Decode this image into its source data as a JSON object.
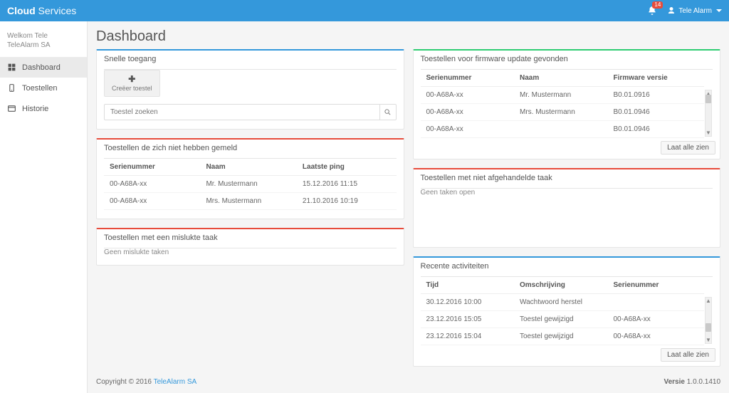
{
  "header": {
    "brand_bold": "Cloud",
    "brand_light": "Services",
    "notif_count": "14",
    "user_label": "Tele Alarm"
  },
  "sidebar": {
    "welcome_line1": "Welkom Tele",
    "welcome_line2": "TeleAlarm SA",
    "items": [
      {
        "label": "Dashboard"
      },
      {
        "label": "Toestellen"
      },
      {
        "label": "Historie"
      }
    ]
  },
  "page": {
    "title": "Dashboard"
  },
  "quick": {
    "title": "Snelle toegang",
    "create_label": "Creëer toestel",
    "search_placeholder": "Toestel zoeken"
  },
  "firmware": {
    "title": "Toestellen voor firmware update gevonden",
    "cols": {
      "serial": "Serienummer",
      "name": "Naam",
      "version": "Firmware versie"
    },
    "rows": [
      {
        "serial": "00-A68A-xx",
        "name": "Mr. Mustermann",
        "version": "B0.01.0916"
      },
      {
        "serial": "00-A68A-xx",
        "name": "Mrs. Mustermann",
        "version": "B0.01.0946"
      },
      {
        "serial": "00-A68A-xx",
        "name": "",
        "version": "B0.01.0946"
      }
    ],
    "footer_btn": "Laat alle zien"
  },
  "noreport": {
    "title": "Toestellen de zich niet hebben gemeld",
    "cols": {
      "serial": "Serienummer",
      "name": "Naam",
      "ping": "Laatste ping"
    },
    "rows": [
      {
        "serial": "00-A68A-xx",
        "name": "Mr. Mustermann",
        "ping": "15.12.2016 11:15"
      },
      {
        "serial": "00-A68A-xx",
        "name": "Mrs. Mustermann",
        "ping": "21.10.2016 10:19"
      }
    ]
  },
  "pending": {
    "title": "Toestellen met niet afgehandelde taak",
    "empty": "Geen taken open"
  },
  "failed": {
    "title": "Toestellen met een mislukte taak",
    "empty": "Geen mislukte taken"
  },
  "recent": {
    "title": "Recente activiteiten",
    "cols": {
      "time": "Tijd",
      "desc": "Omschrijving",
      "serial": "Serienummer"
    },
    "rows": [
      {
        "time": "30.12.2016 10:00",
        "desc": "Wachtwoord herstel",
        "serial": ""
      },
      {
        "time": "23.12.2016 15:05",
        "desc": "Toestel gewijzigd",
        "serial": "00-A68A-xx"
      },
      {
        "time": "23.12.2016 15:04",
        "desc": "Toestel gewijzigd",
        "serial": "00-A68A-xx"
      }
    ],
    "footer_btn": "Laat alle zien"
  },
  "footer": {
    "copyright_prefix": "Copyright © 2016 ",
    "company": "TeleAlarm SA",
    "version_label": "Versie",
    "version": "1.0.0.1410"
  }
}
